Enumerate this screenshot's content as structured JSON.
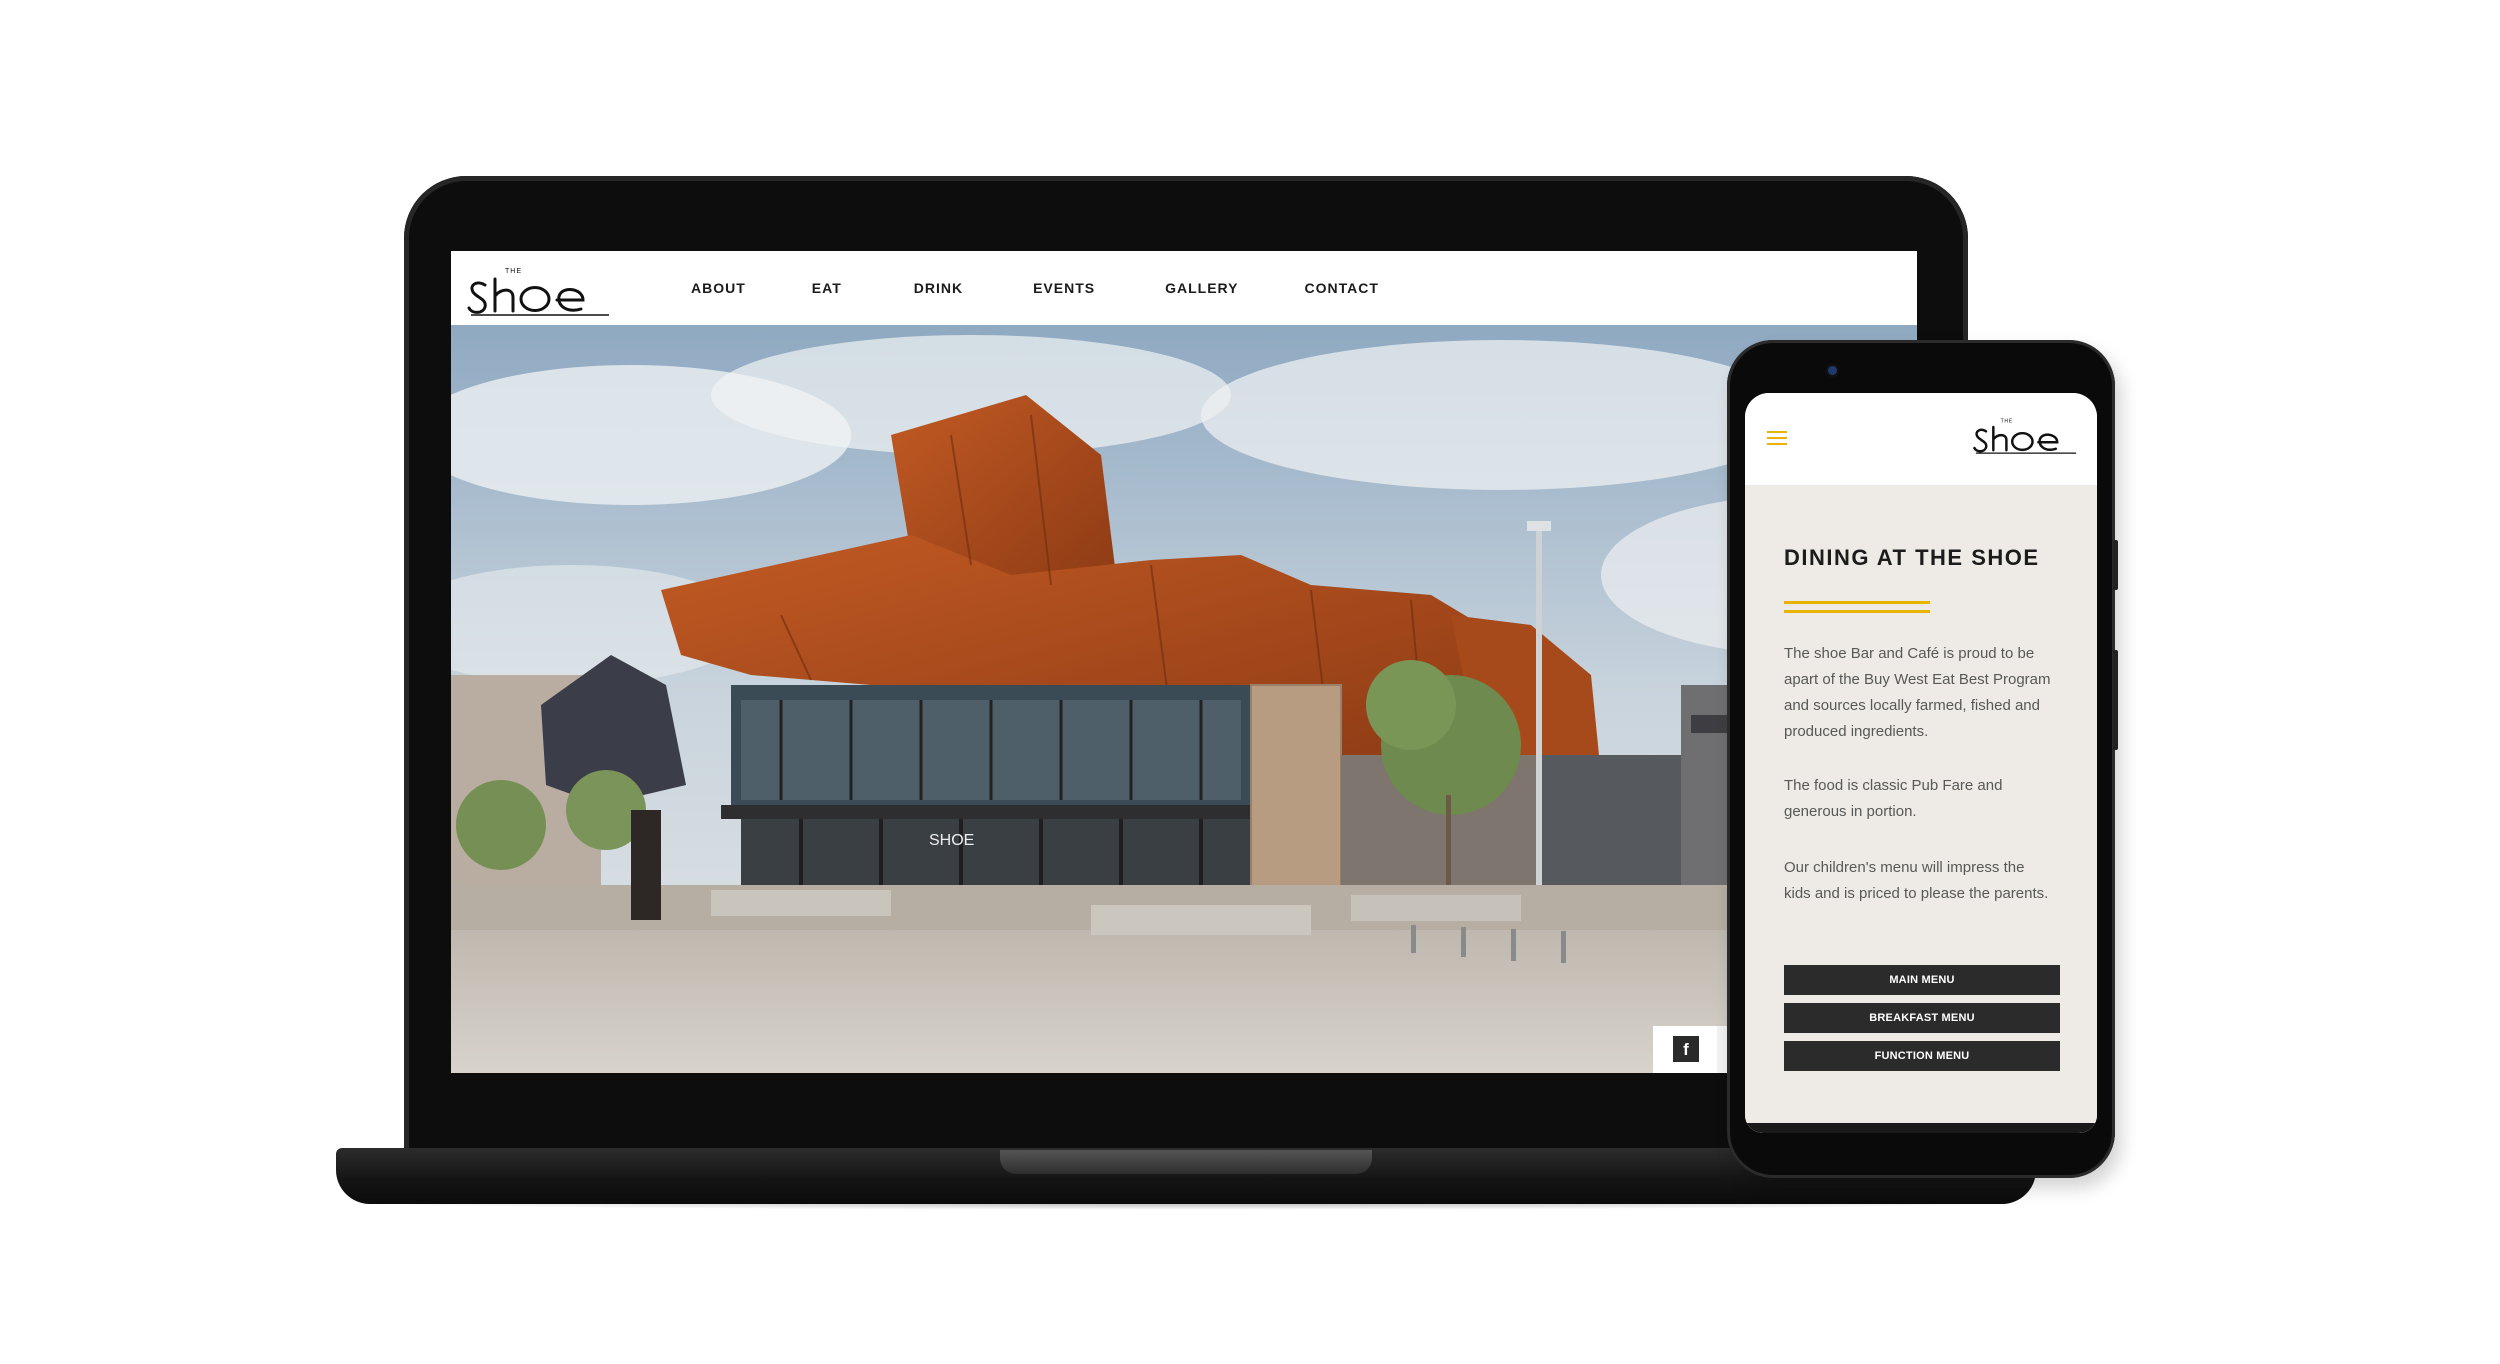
{
  "brand": {
    "logo_small": "THE",
    "logo_main": "SHOE",
    "accent_color": "#e8b400"
  },
  "desktop": {
    "nav": [
      {
        "label": "ABOUT"
      },
      {
        "label": "EAT"
      },
      {
        "label": "DRINK"
      },
      {
        "label": "EVENTS"
      },
      {
        "label": "GALLERY"
      },
      {
        "label": "CONTACT"
      }
    ],
    "hero_image": "building-photo",
    "hero_sign": "SHOE",
    "social": {
      "facebook_label": "f"
    }
  },
  "mobile": {
    "menu_icon": "hamburger-icon",
    "title": "DINING AT THE SHOE",
    "paragraphs": [
      "The shoe Bar and Café is proud to be apart of the Buy West Eat Best Program and sources locally farmed, fished and produced ingredients.",
      "The food is classic Pub Fare and generous in portion.",
      "Our children's menu will impress the kids and is priced to please the parents."
    ],
    "buttons": [
      {
        "label": "MAIN MENU"
      },
      {
        "label": "BREAKFAST MENU"
      },
      {
        "label": "FUNCTION MENU"
      }
    ]
  }
}
